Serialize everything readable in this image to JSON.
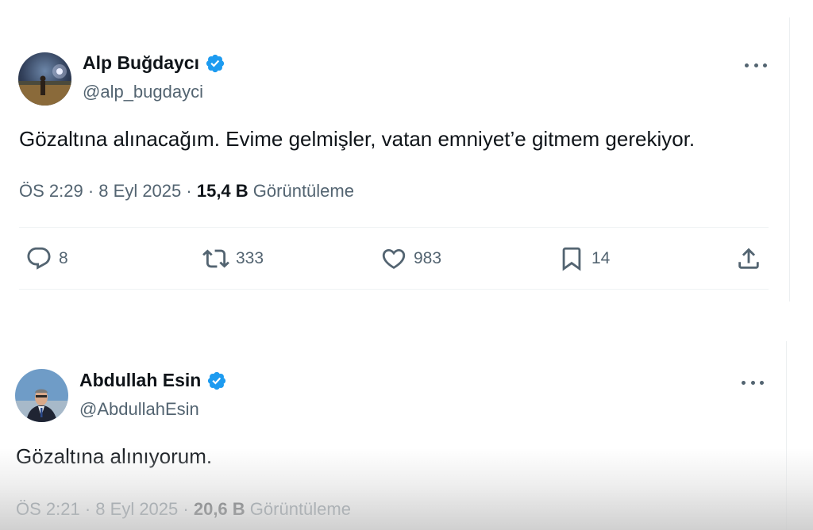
{
  "tweets": [
    {
      "author_name": "Alp Buğdaycı",
      "handle": "@alp_bugdayci",
      "text": "Gözaltına alınacağım. Evime gelmişler, vatan emniyet’e gitmem gerekiyor.",
      "time": "ÖS 2:29",
      "date": "8 Eyl 2025",
      "views": "15,4 B",
      "views_label": "Görüntüleme",
      "replies": "8",
      "reposts": "333",
      "likes": "983",
      "bookmarks": "14",
      "icons": {
        "verified": "verified-badge-icon",
        "more": "more-icon",
        "reply": "reply-icon",
        "repost": "repost-icon",
        "like": "heart-icon",
        "bookmark": "bookmark-icon",
        "share": "share-icon"
      }
    },
    {
      "author_name": "Abdullah Esin",
      "handle": "@AbdullahEsin",
      "text": "Gözaltına alınıyorum.",
      "time": "ÖS 2:21",
      "date": "8 Eyl 2025",
      "views": "20,6 B",
      "views_label": "Görüntüleme"
    }
  ],
  "colors": {
    "verified": "#1d9bf0",
    "secondary_text": "#536471",
    "primary_text": "#0f1419"
  }
}
